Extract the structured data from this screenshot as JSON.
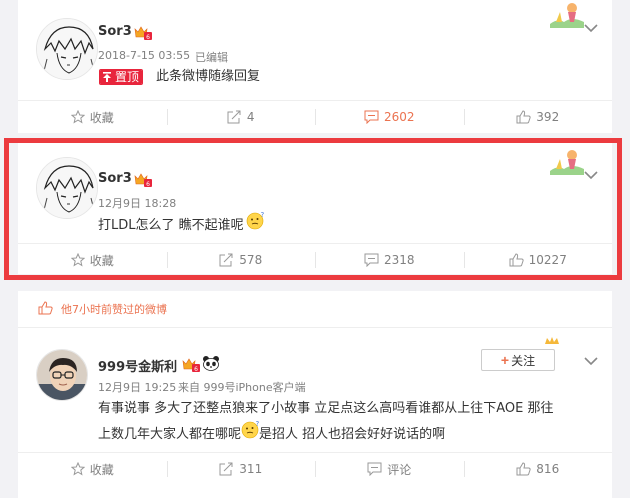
{
  "posts": [
    {
      "username": "Sor3",
      "timestamp": "2018-7-15 03:55",
      "edited": "已编辑",
      "top_badge": "置顶",
      "content": "此条微博随缘回复",
      "actions": {
        "favorite": "收藏",
        "repost": "4",
        "comment": "2602",
        "like": "392"
      }
    },
    {
      "username": "Sor3",
      "timestamp": "12月9日 18:28",
      "content": "打LDL怎么了 瞧不起谁呢",
      "emoji": "thinking-face",
      "actions": {
        "favorite": "收藏",
        "repost": "578",
        "comment": "2318",
        "like": "10227"
      }
    },
    {
      "liked_notice": "他7小时前赞过的微博",
      "username": "999号金斯利",
      "timestamp": "12月9日 19:25",
      "source": "来自 999号iPhone客户端",
      "follow_label": "关注",
      "content_line1": "有事说事 多大了还整点狼来了小故事 立足点这么高吗看谁都从上往下AOE 那往",
      "content_line2a": "上数几年大家人都在哪呢",
      "content_line2b": "是招人 招人也招会好好说话的啊",
      "actions": {
        "favorite": "收藏",
        "repost": "311",
        "comment": "评论",
        "like": "816"
      }
    }
  ],
  "colors": {
    "accent": "#eb7350",
    "highlight_border": "#ec3b3f",
    "top_badge": "#e8253c",
    "page_bg": "#f2f2f5"
  }
}
